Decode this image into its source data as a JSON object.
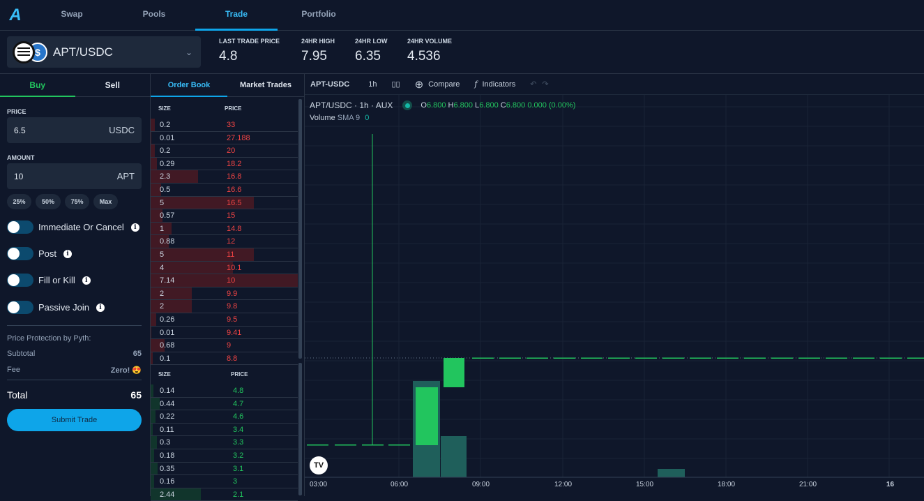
{
  "nav": {
    "logo": "A",
    "tabs": [
      "Swap",
      "Pools",
      "Trade",
      "Portfolio"
    ],
    "active": "Trade"
  },
  "market": {
    "pair": "APT/USDC",
    "coin2_icon": "$"
  },
  "stats": [
    {
      "label": "LAST TRADE PRICE",
      "value": "4.8"
    },
    {
      "label": "24HR HIGH",
      "value": "7.95"
    },
    {
      "label": "24HR LOW",
      "value": "6.35"
    },
    {
      "label": "24HR VOLUME",
      "value": "4.536"
    }
  ],
  "form": {
    "buy": "Buy",
    "sell": "Sell",
    "price_label": "PRICE",
    "price": "6.5",
    "price_unit": "USDC",
    "amount_label": "AMOUNT",
    "amount": "10",
    "amount_unit": "APT",
    "pcts": [
      "25%",
      "50%",
      "75%",
      "Max"
    ],
    "toggles": [
      "Immediate Or Cancel",
      "Post",
      "Fill or Kill",
      "Passive Join"
    ],
    "protection": "Price Protection by Pyth:",
    "subtotal_label": "Subtotal",
    "subtotal": "65",
    "fee_label": "Fee",
    "fee": "Zero! 😍",
    "total_label": "Total",
    "total": "65",
    "submit": "Submit Trade"
  },
  "orderbook": {
    "tabs": [
      "Order Book",
      "Market Trades"
    ],
    "size_h": "SIZE",
    "price_h": "PRICE",
    "asks": [
      [
        "0.2",
        "33"
      ],
      [
        "0.01",
        "27.188"
      ],
      [
        "0.2",
        "20"
      ],
      [
        "0.29",
        "18.2"
      ],
      [
        "2.3",
        "16.8"
      ],
      [
        "0.5",
        "16.6"
      ],
      [
        "5",
        "16.5"
      ],
      [
        "0.57",
        "15"
      ],
      [
        "1",
        "14.8"
      ],
      [
        "0.88",
        "12"
      ],
      [
        "5",
        "11"
      ],
      [
        "4",
        "10.1"
      ],
      [
        "7.14",
        "10"
      ],
      [
        "2",
        "9.9"
      ],
      [
        "2",
        "9.8"
      ],
      [
        "0.26",
        "9.5"
      ],
      [
        "0.01",
        "9.41"
      ],
      [
        "0.68",
        "9"
      ],
      [
        "0.1",
        "8.8"
      ]
    ],
    "bids": [
      [
        "0.14",
        "4.8"
      ],
      [
        "0.44",
        "4.7"
      ],
      [
        "0.22",
        "4.6"
      ],
      [
        "0.11",
        "3.4"
      ],
      [
        "0.3",
        "3.3"
      ],
      [
        "0.18",
        "3.2"
      ],
      [
        "0.35",
        "3.1"
      ],
      [
        "0.16",
        "3"
      ],
      [
        "2.44",
        "2.1"
      ]
    ],
    "ask_color": "#ef4444",
    "bid_color": "#22c55e"
  },
  "chart": {
    "symbol": "APT-USDC",
    "interval": "1h",
    "compare": "Compare",
    "indicators": "Indicators",
    "legend_title": "APT/USDC · 1h · AUX",
    "o": "6.800",
    "h": "6.800",
    "l": "6.800",
    "c": "6.800",
    "change": "0.000 (0.00%)",
    "volume_label": "Volume",
    "sma": "SMA 9",
    "sma_val": "0",
    "x_labels": [
      "03:00",
      "06:00",
      "09:00",
      "12:00",
      "15:00",
      "18:00",
      "21:00",
      "16"
    ]
  }
}
